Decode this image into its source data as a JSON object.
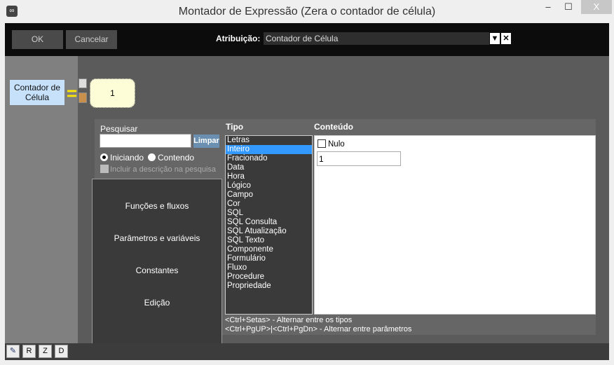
{
  "window": {
    "title": "Montador de Expressão (Zera o contador de célula)",
    "minimize": "‒",
    "maximize": "☐",
    "close": "X"
  },
  "header": {
    "ok": "OK",
    "cancel": "Cancelar",
    "attribution_label": "Atribuição:",
    "attribution_value": "Contador de Célula"
  },
  "expression": {
    "target": "Contador de Célula",
    "equals": "=",
    "value": "1"
  },
  "search": {
    "label": "Pesquisar",
    "value": "",
    "clear": "Limpar",
    "opt_starting": "Iniciando",
    "opt_containing": "Contendo",
    "include_desc": "Incluir a descrição na pesquisa"
  },
  "nav": [
    "Funções e fluxos",
    "Parâmetros e variáveis",
    "Constantes",
    "Edição"
  ],
  "tipo": {
    "header": "Tipo",
    "selected": "Inteiro",
    "items": [
      "Letras",
      "Inteiro",
      "Fracionado",
      "Data",
      "Hora",
      "Lógico",
      "Campo",
      "Cor",
      "SQL",
      "SQL Consulta",
      "SQL Atualização",
      "SQL Texto",
      "Componente",
      "Formulário",
      "Fluxo",
      "Procedure",
      "Propriedade"
    ]
  },
  "conteudo": {
    "header": "Conteúdo",
    "null_label": "Nulo",
    "null_checked": false,
    "value": "1"
  },
  "hints": [
    "<Ctrl+Setas> - Alternar entre os tipos",
    "<Ctrl+PgUP>|<Ctrl+PgDn> - Alternar entre parâmetros"
  ],
  "bottom": {
    "r": "R",
    "z": "Z",
    "d": "D"
  }
}
